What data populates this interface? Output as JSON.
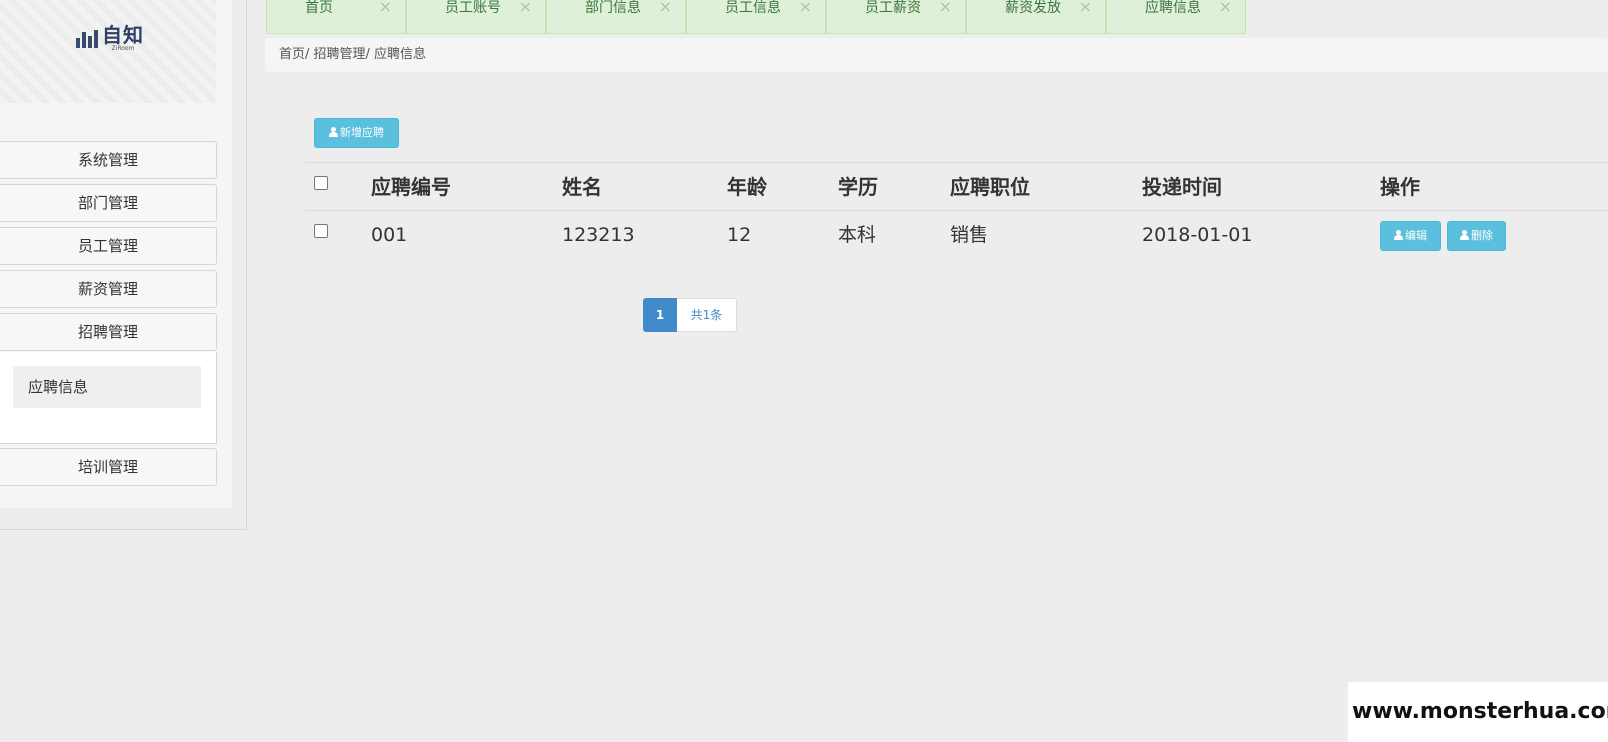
{
  "logo": {
    "text": "自知",
    "subtext": "ZiRoom"
  },
  "sidebar": {
    "items": [
      {
        "label": "系统管理"
      },
      {
        "label": "部门管理"
      },
      {
        "label": "员工管理"
      },
      {
        "label": "薪资管理"
      },
      {
        "label": "招聘管理"
      },
      {
        "label": "培训管理"
      }
    ],
    "submenu": [
      {
        "label": "应聘信息"
      }
    ]
  },
  "tabs": [
    {
      "label": "首页",
      "close": "×"
    },
    {
      "label": "员工账号",
      "close": "×"
    },
    {
      "label": "部门信息",
      "close": "×"
    },
    {
      "label": "员工信息",
      "close": "×"
    },
    {
      "label": "员工薪资",
      "close": "×"
    },
    {
      "label": "薪资发放",
      "close": "×"
    },
    {
      "label": "应聘信息",
      "close": "×"
    }
  ],
  "breadcrumb": "首页/ 招聘管理/ 应聘信息",
  "toolbar": {
    "add_label": "新增应聘",
    "add_icon": "user-icon"
  },
  "table": {
    "headers": [
      "应聘编号",
      "姓名",
      "年龄",
      "学历",
      "应聘职位",
      "投递时间",
      "操作"
    ],
    "rows": [
      {
        "id": "001",
        "name": "123213",
        "age": "12",
        "education": "本科",
        "position": "销售",
        "date": "2018-01-01"
      }
    ],
    "actions": {
      "edit_label": "编辑",
      "delete_label": "删除"
    }
  },
  "pagination": {
    "current": "1",
    "total": "共1条"
  },
  "watermark": "www.monsterhua.com",
  "colors": {
    "primary": "#428bca",
    "info": "#5bc0de",
    "tab_bg": "#dff0d8",
    "tab_text": "#3c763d"
  }
}
